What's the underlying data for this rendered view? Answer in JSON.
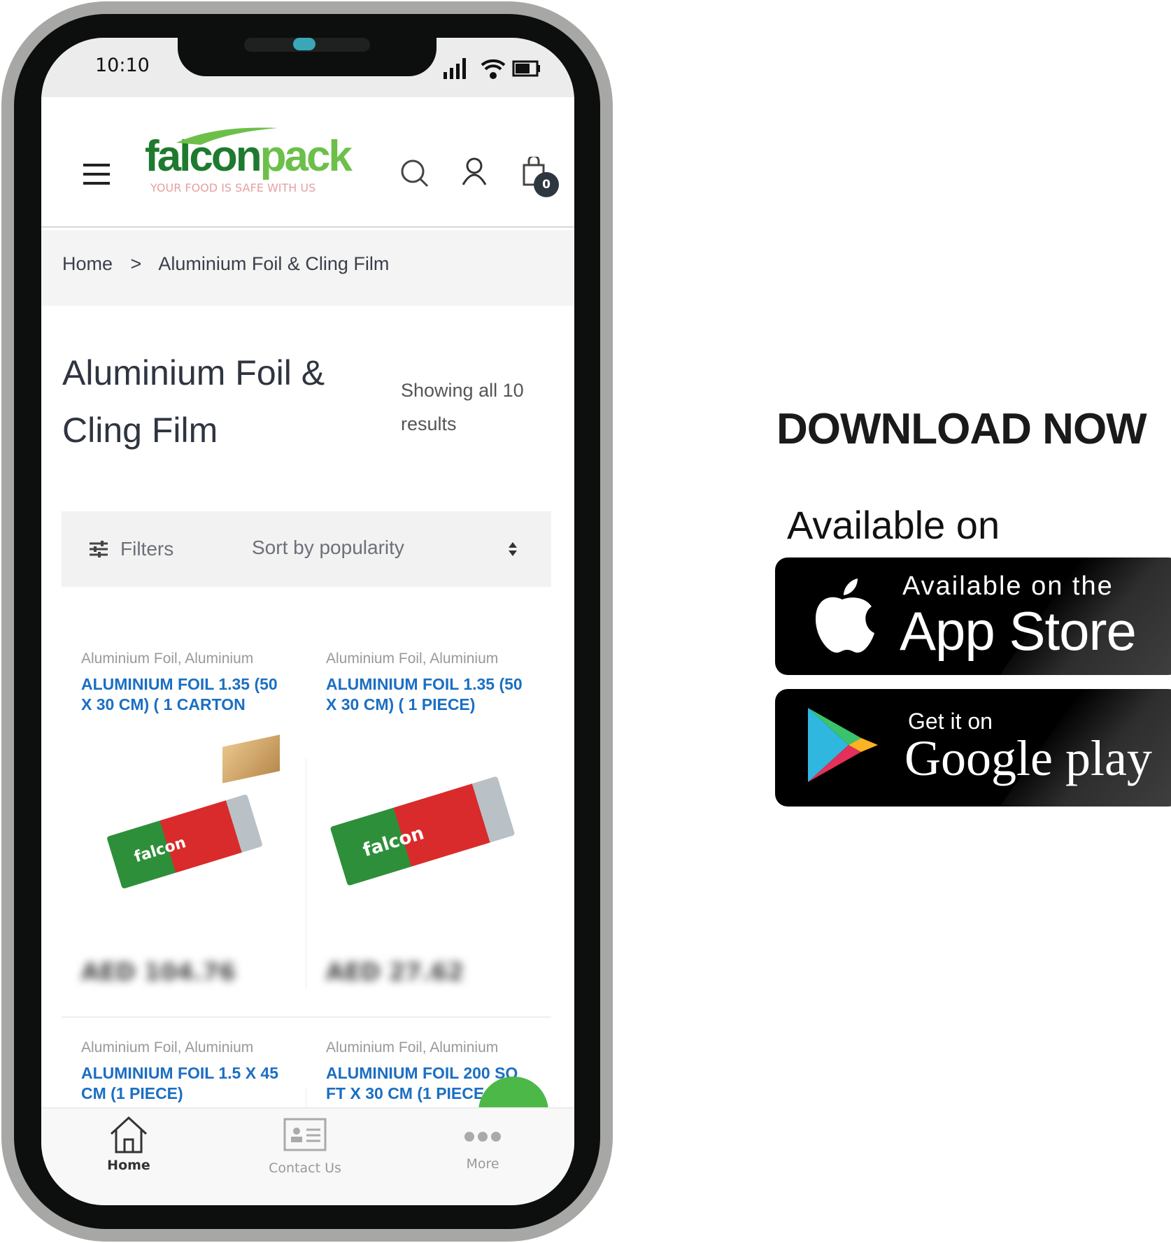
{
  "status_bar": {
    "time": "10:10"
  },
  "header": {
    "logo_text": "falconpack",
    "logo_tagline": "YOUR FOOD IS SAFE WITH US",
    "cart_count": "0"
  },
  "breadcrumb": {
    "home": "Home",
    "separator": ">",
    "current": "Aluminium Foil & Cling Film"
  },
  "page": {
    "title": "Aluminium Foil & Cling Film",
    "result_count": "Showing all 10 results"
  },
  "toolbar": {
    "filters_label": "Filters",
    "sort_value": "Sort by popularity"
  },
  "products": [
    {
      "category": "Aluminium Foil, Aluminium",
      "title": "ALUMINIUM FOIL 1.35 (50 X 30 CM) ( 1 CARTON",
      "price": "AED 104.76"
    },
    {
      "category": "Aluminium Foil, Aluminium",
      "title": "ALUMINIUM FOIL 1.35 (50 X 30 CM) ( 1 PIECE)",
      "price": "AED 27.62"
    },
    {
      "category": "Aluminium Foil, Aluminium",
      "title": "ALUMINIUM FOIL 1.5 X 45 CM (1 PIECE)"
    },
    {
      "category": "Aluminium Foil, Aluminium",
      "title": "ALUMINIUM FOIL 200 SQ FT X 30 CM (1 PIECE"
    }
  ],
  "bottom_nav": [
    {
      "label": "Home",
      "icon": "home-icon"
    },
    {
      "label": "Contact Us",
      "icon": "contact-card-icon"
    },
    {
      "label": "More",
      "icon": "more-dots-icon"
    }
  ],
  "promo": {
    "heading": "DOWNLOAD NOW",
    "subheading": "Available on",
    "app_store": {
      "line1": "Available on the",
      "line2": "App Store"
    },
    "google_play": {
      "line1": "Get it on",
      "line2": "Google play"
    }
  },
  "colors": {
    "brand_green": "#2e9a3a",
    "link_blue": "#1b6fc2",
    "chat_green": "#4cb848"
  }
}
